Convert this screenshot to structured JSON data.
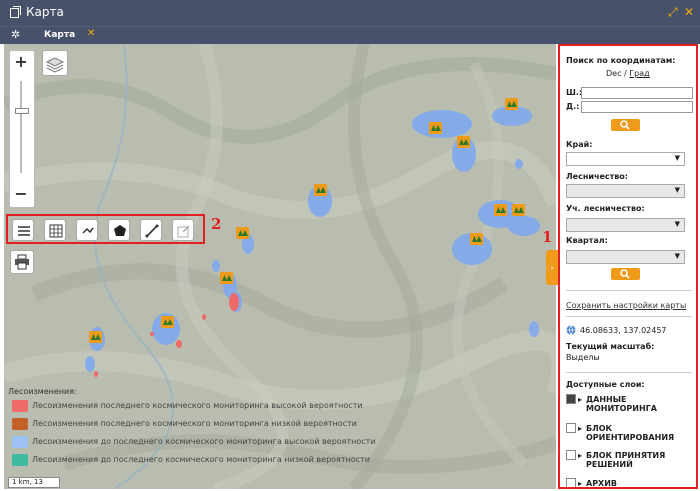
{
  "window": {
    "title": "Карта",
    "tab_label": "Карта"
  },
  "map": {
    "markers_count": 13,
    "legend": {
      "title": "Лесоизменения:",
      "items": [
        {
          "label": "Лесоизменения последнего космического мониторинга высокой вероятности",
          "color": "#f06a6a"
        },
        {
          "label": "Лесоизменения последнего космического мониторинга низкой вероятности",
          "color": "#c2612a"
        },
        {
          "label": "Лесоизменения до последнего космического мониторинга высокой вероятности",
          "color": "#9ec2f5"
        },
        {
          "label": "Лесоизменения до последнего космического мониторинга низкой вероятности",
          "color": "#3fb9a0"
        }
      ]
    },
    "scale_label": "1 km, 13",
    "zoom_in": "+",
    "zoom_out": "−",
    "annotation_1": "1",
    "annotation_2": "2"
  },
  "panel": {
    "search_title": "Поиск по координатам:",
    "dec": "Dec",
    "slash": "/",
    "grad": "Град",
    "lat_label": "Ш.:",
    "lon_label": "Д.:",
    "kray_label": "Край:",
    "lesnichestvo_label": "Лесничество:",
    "uch_lesnichestvo_label": "Уч. лесничество:",
    "kvartal_label": "Квартал:",
    "save_settings": "Сохранить настройки карты",
    "coords": "46.08633, 137.02457",
    "scale_title": "Текущий масштаб:",
    "scale_value": "Выделы",
    "layers_title": "Доступные слои:",
    "layers": [
      {
        "label": "ДАННЫЕ МОНИТОРИНГА"
      },
      {
        "label": "БЛОК ОРИЕНТИРОВАНИЯ"
      },
      {
        "label": "БЛОК ПРИНЯТИЯ РЕШЕНИЙ"
      },
      {
        "label": "АРХИВ"
      }
    ]
  },
  "colors": {
    "accent": "#f09a1a",
    "titlebar": "#47516a",
    "highlight": "#e02020"
  }
}
